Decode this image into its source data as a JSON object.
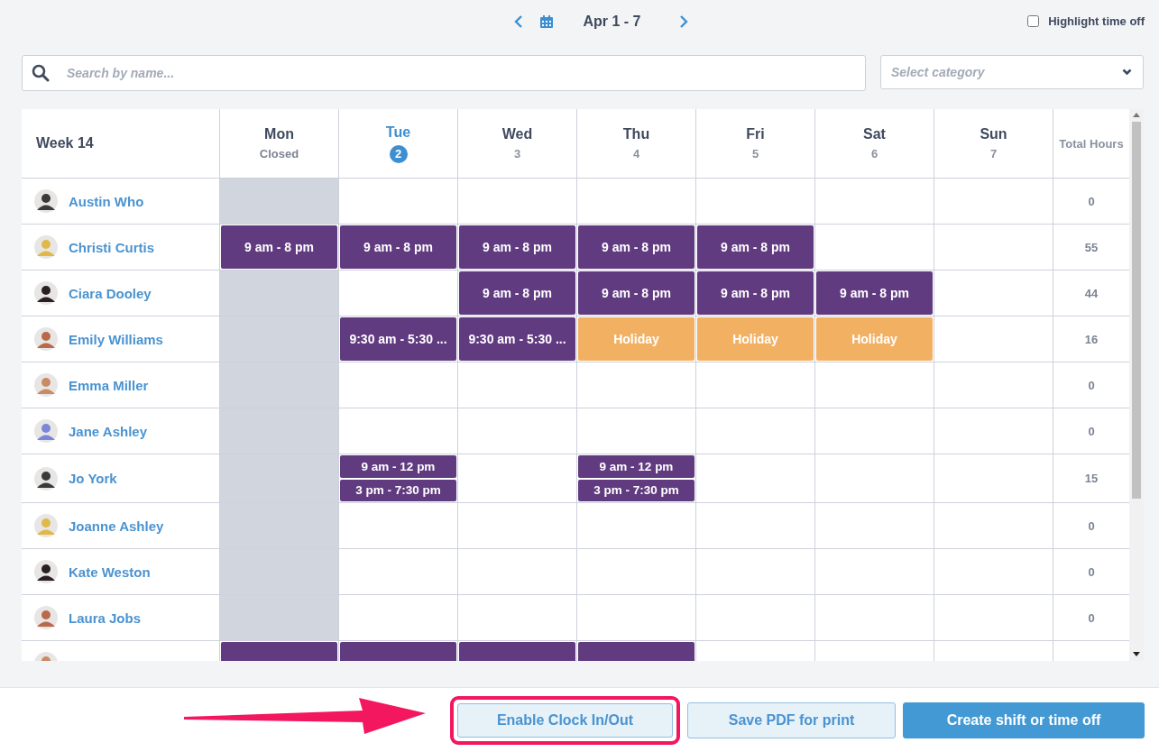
{
  "nav": {
    "range": "Apr 1 - 7",
    "highlight_time_off": {
      "label": "Highlight time off",
      "checked": false
    }
  },
  "search": {
    "placeholder": "Search by name..."
  },
  "category": {
    "placeholder": "Select category"
  },
  "table": {
    "week": "Week 14",
    "total_heading": "Total Hours",
    "days": [
      {
        "name": "Mon",
        "sub": "Closed",
        "closed": true,
        "selected": false
      },
      {
        "name": "Tue",
        "sub": "2",
        "closed": false,
        "selected": true
      },
      {
        "name": "Wed",
        "sub": "3",
        "closed": false,
        "selected": false
      },
      {
        "name": "Thu",
        "sub": "4",
        "closed": false,
        "selected": false
      },
      {
        "name": "Fri",
        "sub": "5",
        "closed": false,
        "selected": false
      },
      {
        "name": "Sat",
        "sub": "6",
        "closed": false,
        "selected": false
      },
      {
        "name": "Sun",
        "sub": "7",
        "closed": false,
        "selected": false
      }
    ],
    "rows": [
      {
        "name": "Austin Who",
        "total": "0",
        "days": [
          {
            "kind": "empty"
          },
          {
            "kind": "empty"
          },
          {
            "kind": "empty"
          },
          {
            "kind": "empty"
          },
          {
            "kind": "empty"
          },
          {
            "kind": "empty"
          },
          {
            "kind": "empty"
          }
        ]
      },
      {
        "name": "Christi Curtis",
        "total": "55",
        "days": [
          {
            "kind": "shift",
            "labels": [
              "9 am - 8 pm"
            ]
          },
          {
            "kind": "shift",
            "labels": [
              "9 am - 8 pm"
            ]
          },
          {
            "kind": "shift",
            "labels": [
              "9 am - 8 pm"
            ]
          },
          {
            "kind": "shift",
            "labels": [
              "9 am - 8 pm"
            ]
          },
          {
            "kind": "shift",
            "labels": [
              "9 am - 8 pm"
            ]
          },
          {
            "kind": "empty"
          },
          {
            "kind": "empty"
          }
        ]
      },
      {
        "name": "Ciara Dooley",
        "total": "44",
        "days": [
          {
            "kind": "empty"
          },
          {
            "kind": "empty"
          },
          {
            "kind": "shift",
            "labels": [
              "9 am - 8 pm"
            ]
          },
          {
            "kind": "shift",
            "labels": [
              "9 am - 8 pm"
            ]
          },
          {
            "kind": "shift",
            "labels": [
              "9 am - 8 pm"
            ]
          },
          {
            "kind": "shift",
            "labels": [
              "9 am - 8 pm"
            ]
          },
          {
            "kind": "empty"
          }
        ]
      },
      {
        "name": "Emily Williams",
        "total": "16",
        "days": [
          {
            "kind": "empty"
          },
          {
            "kind": "shift",
            "labels": [
              "9:30 am - 5:30 ..."
            ]
          },
          {
            "kind": "shift",
            "labels": [
              "9:30 am - 5:30 ..."
            ]
          },
          {
            "kind": "holiday",
            "labels": [
              "Holiday"
            ]
          },
          {
            "kind": "holiday",
            "labels": [
              "Holiday"
            ]
          },
          {
            "kind": "holiday",
            "labels": [
              "Holiday"
            ]
          },
          {
            "kind": "empty"
          }
        ]
      },
      {
        "name": "Emma Miller",
        "total": "0",
        "days": [
          {
            "kind": "empty"
          },
          {
            "kind": "empty"
          },
          {
            "kind": "empty"
          },
          {
            "kind": "empty"
          },
          {
            "kind": "empty"
          },
          {
            "kind": "empty"
          },
          {
            "kind": "empty"
          }
        ]
      },
      {
        "name": "Jane Ashley",
        "total": "0",
        "days": [
          {
            "kind": "empty"
          },
          {
            "kind": "empty"
          },
          {
            "kind": "empty"
          },
          {
            "kind": "empty"
          },
          {
            "kind": "empty"
          },
          {
            "kind": "empty"
          },
          {
            "kind": "empty"
          }
        ]
      },
      {
        "name": "Jo York",
        "total": "15",
        "days": [
          {
            "kind": "empty"
          },
          {
            "kind": "shift",
            "labels": [
              "9 am - 12 pm",
              "3 pm - 7:30 pm"
            ]
          },
          {
            "kind": "empty"
          },
          {
            "kind": "shift",
            "labels": [
              "9 am - 12 pm",
              "3 pm - 7:30 pm"
            ]
          },
          {
            "kind": "empty"
          },
          {
            "kind": "empty"
          },
          {
            "kind": "empty"
          }
        ]
      },
      {
        "name": "Joanne Ashley",
        "total": "0",
        "days": [
          {
            "kind": "empty"
          },
          {
            "kind": "empty"
          },
          {
            "kind": "empty"
          },
          {
            "kind": "empty"
          },
          {
            "kind": "empty"
          },
          {
            "kind": "empty"
          },
          {
            "kind": "empty"
          }
        ]
      },
      {
        "name": "Kate Weston",
        "total": "0",
        "days": [
          {
            "kind": "empty"
          },
          {
            "kind": "empty"
          },
          {
            "kind": "empty"
          },
          {
            "kind": "empty"
          },
          {
            "kind": "empty"
          },
          {
            "kind": "empty"
          },
          {
            "kind": "empty"
          }
        ]
      },
      {
        "name": "Laura Jobs",
        "total": "0",
        "days": [
          {
            "kind": "empty"
          },
          {
            "kind": "empty"
          },
          {
            "kind": "empty"
          },
          {
            "kind": "empty"
          },
          {
            "kind": "empty"
          },
          {
            "kind": "empty"
          },
          {
            "kind": "empty"
          }
        ]
      },
      {
        "days": [
          {
            "kind": "shift"
          },
          {
            "kind": "shift"
          },
          {
            "kind": "shift"
          },
          {
            "kind": "shift"
          },
          {
            "kind": "empty"
          },
          {
            "kind": "empty"
          },
          {
            "kind": "empty"
          }
        ]
      }
    ]
  },
  "buttons": [
    {
      "label": "Enable Clock In/Out",
      "kind": "light",
      "highlighted": true
    },
    {
      "label": "Save PDF for print",
      "kind": "light",
      "highlighted": false
    },
    {
      "label": "Create shift or time off",
      "kind": "primary",
      "highlighted": false
    }
  ]
}
